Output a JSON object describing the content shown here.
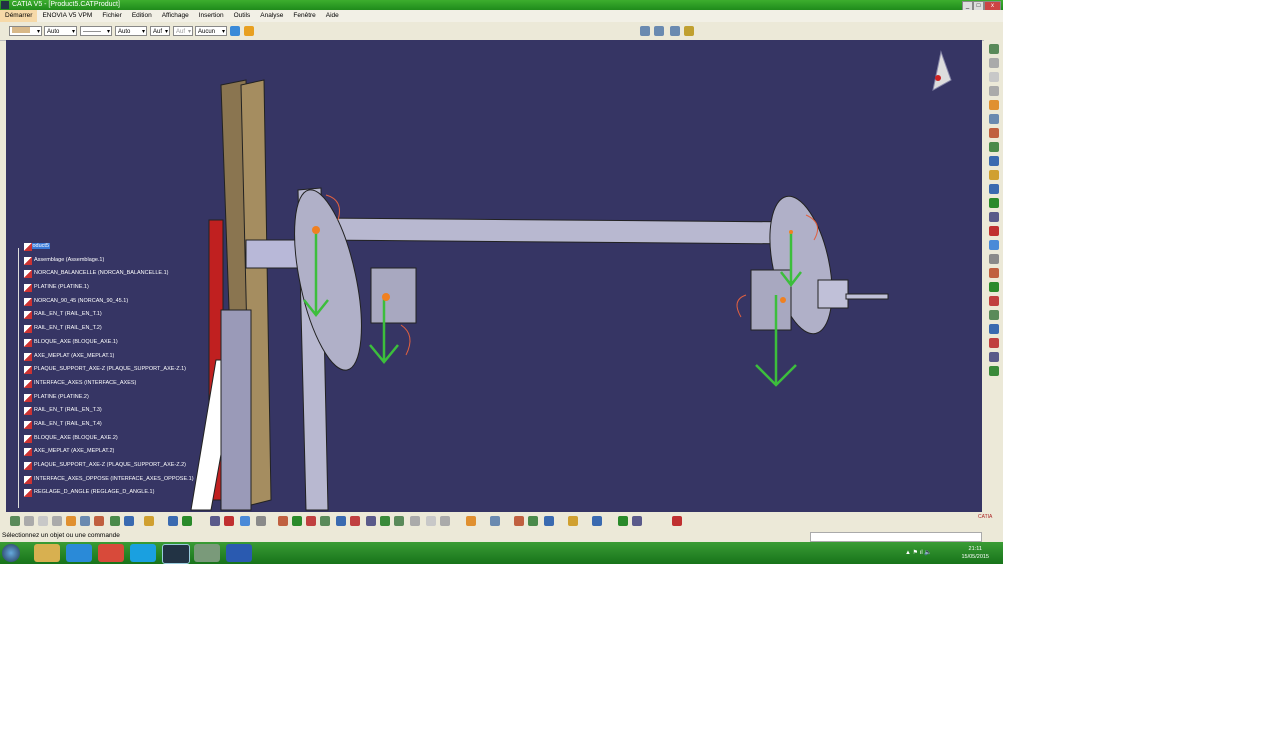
{
  "window": {
    "title": "CATIA V5 - [Product5.CATProduct]"
  },
  "menu": [
    "Démarrer",
    "ENOVIA V5 VPM",
    "Fichier",
    "Edition",
    "Affichage",
    "Insertion",
    "Outils",
    "Analyse",
    "Fenêtre",
    "Aide"
  ],
  "toolbar": {
    "color_swatch": "#d8b888",
    "transparency": "Auto",
    "line_type": "———",
    "line_weight": "Auto",
    "layer_a": "Auf",
    "layer_b": "Auf",
    "layer": "Aucun"
  },
  "tree": {
    "root": "Product5",
    "items": [
      "Assemblage (Assemblage.1)",
      "NORCAN_BALANCELLE (NORCAN_BALANCELLE.1)",
      "PLATINE (PLATINE.1)",
      "NORCAN_90_45 (NORCAN_90_45.1)",
      "RAIL_EN_T (RAIL_EN_T.1)",
      "RAIL_EN_T (RAIL_EN_T.2)",
      "BLOQUE_AXE (BLOQUE_AXE.1)",
      "AXE_MEPLAT (AXE_MEPLAT.1)",
      "PLAQUE_SUPPORT_AXE-Z (PLAQUE_SUPPORT_AXE-Z.1)",
      "INTERFACE_AXES (INTERFACE_AXES)",
      "PLATINE (PLATINE.2)",
      "RAIL_EN_T (RAIL_EN_T.3)",
      "RAIL_EN_T (RAIL_EN_T.4)",
      "BLOQUE_AXE (BLOQUE_AXE.2)",
      "AXE_MEPLAT (AXE_MEPLAT.2)",
      "PLAQUE_SUPPORT_AXE-Z (PLAQUE_SUPPORT_AXE-Z.2)",
      "INTERFACE_AXES_OPPOSE (INTERFACE_AXES_OPPOSE.1)",
      "REGLAGE_D_ANGLE (REGLAGE_D_ANGLE.1)"
    ]
  },
  "status": {
    "message": "Sélectionnez un objet ou une commande"
  },
  "clock": {
    "time": "21:11",
    "date": "15/05/2015"
  },
  "brand": "CATIA"
}
